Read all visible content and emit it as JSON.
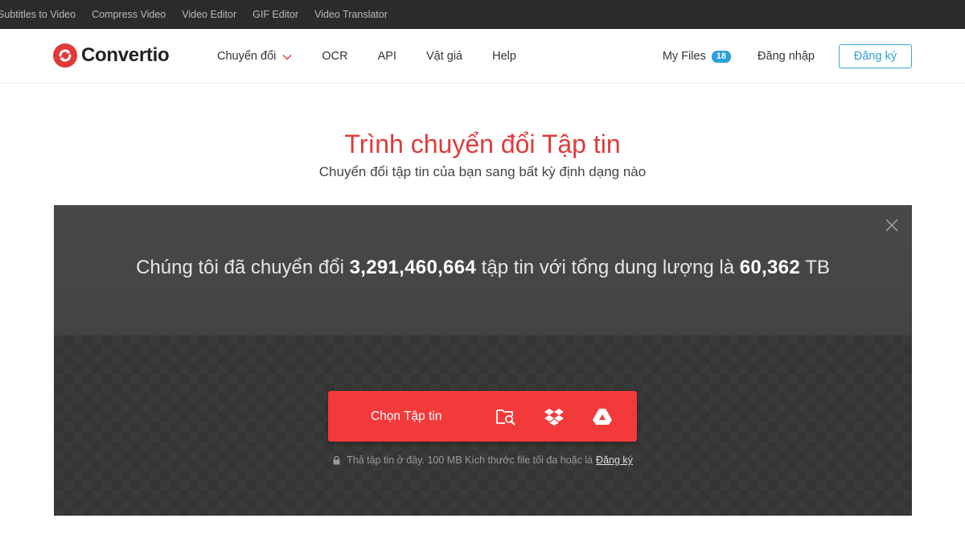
{
  "top_links": [
    "Subtitles to Video",
    "Compress Video",
    "Video Editor",
    "GIF Editor",
    "Video Translator"
  ],
  "brand": {
    "name": "Convertio",
    "color": "#e03a3a"
  },
  "nav": {
    "items": [
      {
        "label": "Chuyển đổi",
        "dropdown": true
      },
      {
        "label": "OCR"
      },
      {
        "label": "API"
      },
      {
        "label": "Vật giá"
      },
      {
        "label": "Help"
      }
    ],
    "my_files": "My Files",
    "files_count": "18",
    "login": "Đăng nhập",
    "signup": "Đăng ký",
    "accent": "#2a9fd8"
  },
  "hero": {
    "title": "Trình chuyển đổi Tập tin",
    "subtitle": "Chuyển đổi tập tin của bạn sang bất kỳ định dạng nào"
  },
  "stats": {
    "prefix": "Chúng tôi đã chuyển đổi ",
    "files": "3,291,460,664",
    "middle": " tập tin với tổng dung lượng là ",
    "size": "60,362",
    "suffix": " TB"
  },
  "upload": {
    "button_label": "Chọn Tập tin",
    "sources": [
      "folder-search-icon",
      "dropbox-icon",
      "google-drive-icon"
    ],
    "hint_text": "Thả tập tin ở đây. 100 MB Kích thước file tối đa hoặc là",
    "hint_link": "Đăng ký",
    "button_color": "#f23a3a"
  }
}
